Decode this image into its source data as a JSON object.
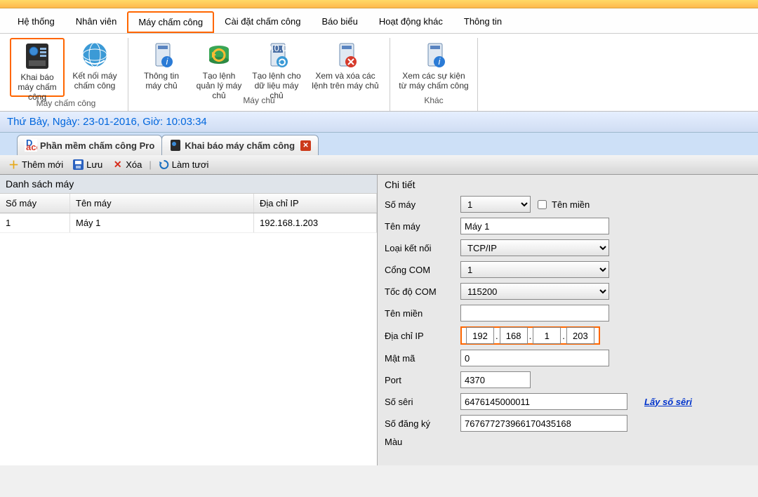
{
  "menu": {
    "items": [
      "Hệ thống",
      "Nhân viên",
      "Máy chấm công",
      "Cài đặt chấm công",
      "Báo biểu",
      "Hoạt động khác",
      "Thông tin"
    ],
    "active_index": 2
  },
  "ribbon": {
    "groups": [
      {
        "name": "Máy chấm công",
        "buttons": [
          {
            "label": "Khai báo máy chấm công",
            "icon": "fingerprint-device-icon",
            "highlight": true
          },
          {
            "label": "Kết nối máy chấm công",
            "icon": "globe-connect-icon"
          }
        ]
      },
      {
        "name": "Máy chủ",
        "buttons": [
          {
            "label": "Thông tin máy chủ",
            "icon": "server-info-icon"
          },
          {
            "label": "Tạo lệnh quản lý máy chủ",
            "icon": "server-refresh-icon"
          },
          {
            "label": "Tạo lệnh cho dữ liệu máy chủ",
            "icon": "server-data-icon"
          },
          {
            "label": "Xem và xóa các lệnh trên máy chủ",
            "icon": "server-delete-icon"
          }
        ]
      },
      {
        "name": "Khác",
        "buttons": [
          {
            "label": "Xem các sự kiện từ máy chấm công",
            "icon": "server-events-icon"
          }
        ]
      }
    ]
  },
  "datetime": "Thứ Bảy, Ngày: 23-01-2016, Giờ: 10:03:34",
  "tabs": [
    {
      "label": "Phần mềm chấm công Pro",
      "closable": false,
      "icon": "app-icon"
    },
    {
      "label": "Khai báo máy chấm công",
      "closable": true,
      "icon": "device-small-icon"
    }
  ],
  "toolbar": {
    "add": "Thêm mới",
    "save": "Lưu",
    "delete": "Xóa",
    "refresh": "Làm tươi"
  },
  "list": {
    "title": "Danh sách máy",
    "columns": [
      "Số máy",
      "Tên máy",
      "Địa chỉ IP"
    ],
    "rows": [
      {
        "so_may": "1",
        "ten_may": "Máy 1",
        "dia_chi_ip": "192.168.1.203"
      }
    ]
  },
  "detail": {
    "title": "Chi tiết",
    "labels": {
      "so_may": "Số máy",
      "ten_mien_chk": "Tên miền",
      "ten_may": "Tên máy",
      "loai_ket_noi": "Loại kết nối",
      "cong_com": "Cổng COM",
      "toc_do_com": "Tốc độ COM",
      "ten_mien": "Tên miền",
      "dia_chi_ip": "Địa chỉ IP",
      "mat_ma": "Mật mã",
      "port": "Port",
      "so_seri": "Số sêri",
      "so_dang_ky": "Số đăng ký",
      "mau": "Màu"
    },
    "values": {
      "so_may": "1",
      "ten_may": "Máy 1",
      "loai_ket_noi": "TCP/IP",
      "cong_com": "1",
      "toc_do_com": "115200",
      "ten_mien": "",
      "ip": [
        "192",
        "168",
        "1",
        "203"
      ],
      "mat_ma": "0",
      "port": "4370",
      "so_seri": "6476145000011",
      "so_dang_ky": "767677273966170435168"
    },
    "link_get_serial": "Lấy số sêri"
  }
}
